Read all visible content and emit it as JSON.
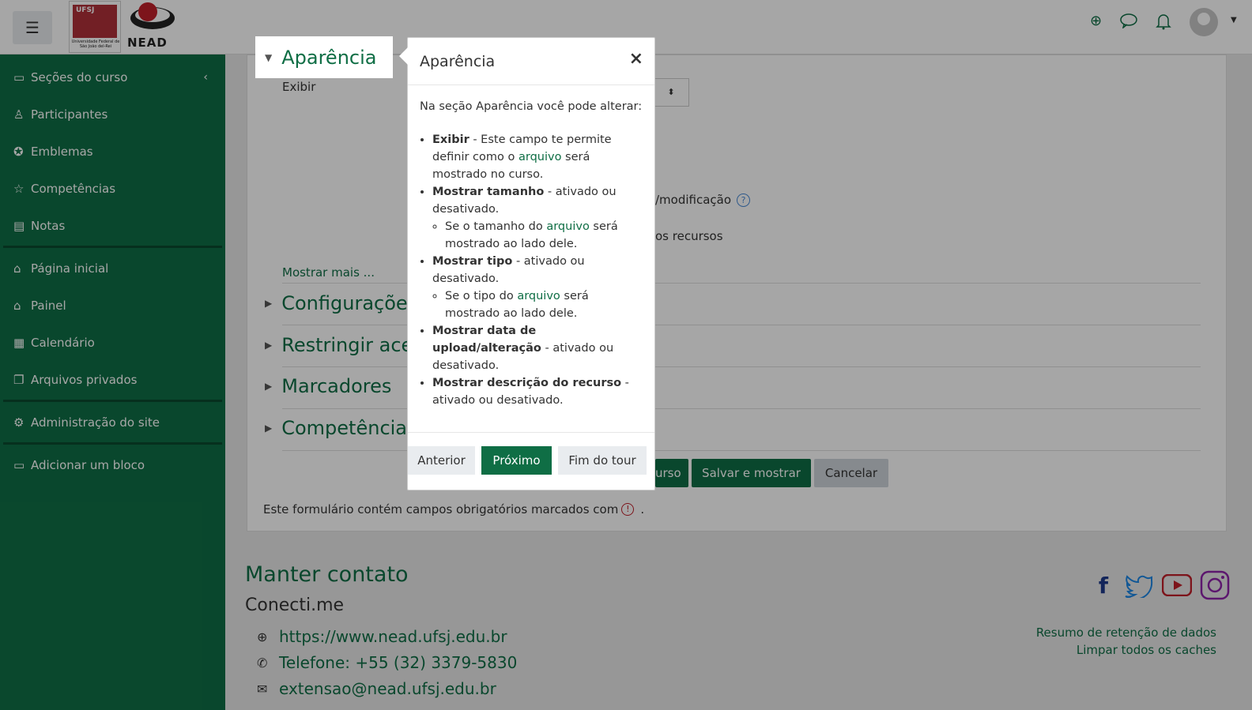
{
  "navbar": {
    "logo_ufsj_text": "UFSJ",
    "logo_ufsj_sub": "Universidade Federal de São João del-Rei",
    "logo_nead_text": "NEAD"
  },
  "sidebar": {
    "items": [
      {
        "label": "Seções do curso",
        "icon": "folder-icon"
      },
      {
        "label": "Participantes",
        "icon": "users-icon"
      },
      {
        "label": "Emblemas",
        "icon": "badge-icon"
      },
      {
        "label": "Competências",
        "icon": "star-icon"
      },
      {
        "label": "Notas",
        "icon": "book-icon"
      },
      {
        "label": "Página inicial",
        "icon": "home-icon"
      },
      {
        "label": "Painel",
        "icon": "home-icon"
      },
      {
        "label": "Calendário",
        "icon": "calendar-icon"
      },
      {
        "label": "Arquivos privados",
        "icon": "files-icon"
      },
      {
        "label": "Administração do site",
        "icon": "gear-icon"
      },
      {
        "label": "Adicionar um bloco",
        "icon": "folder-icon"
      }
    ]
  },
  "form": {
    "section_appearance": "Aparência",
    "exibir_label": "Exibir",
    "modificacao_fragment": "/modificação",
    "recursos_fragment": "os recursos",
    "mostrar_mais": "Mostrar mais ...",
    "sections": [
      "Configuraçõe",
      "Restringir ace",
      "Marcadores",
      "Competência"
    ],
    "btn_curso_fragment": "urso",
    "btn_salvar_mostrar": "Salvar e mostrar",
    "btn_cancelar": "Cancelar",
    "required_note": "Este formulário contém campos obrigatórios marcados com",
    "required_note_end": "."
  },
  "footer": {
    "title": "Manter contato",
    "subtitle": "Conecti.me",
    "website": "https://www.nead.ufsj.edu.br",
    "phone": "Telefone: +55 (32) 3379-5830",
    "email": "extensao@nead.ufsj.edu.br",
    "link_retencao": "Resumo de retenção de dados",
    "link_caches": "Limpar todos os caches"
  },
  "tour": {
    "title": "Aparência",
    "intro": "Na seção Aparência você pode alterar:",
    "items": {
      "exibir_b": "Exibir",
      "exibir_1": " - Este campo te permite definir como o ",
      "exibir_link": "arquivo",
      "exibir_2": " será mostrado no curso.",
      "tamanho_b": "Mostrar tamanho",
      "tamanho_t": " - ativado ou desativado.",
      "tamanho_sub_1": "Se o tamanho do ",
      "tamanho_sub_link": "arquivo",
      "tamanho_sub_2": " será mostrado ao lado dele.",
      "tipo_b": "Mostrar tipo",
      "tipo_t": " - ativado ou desativado.",
      "tipo_sub_1": "Se o tipo do ",
      "tipo_sub_link": "arquivo",
      "tipo_sub_2": " será mostrado ao lado dele.",
      "data_b": "Mostrar data de upload/alteração",
      "data_t": " - ativado ou desativado.",
      "desc_b": "Mostrar descrição do recurso",
      "desc_t": " - ativado ou desativado."
    },
    "btn_prev": "Anterior",
    "btn_next": "Próximo",
    "btn_end": "Fim do tour"
  },
  "colors": {
    "brand": "#0f6e45",
    "sidebar": "#0f6e45"
  }
}
